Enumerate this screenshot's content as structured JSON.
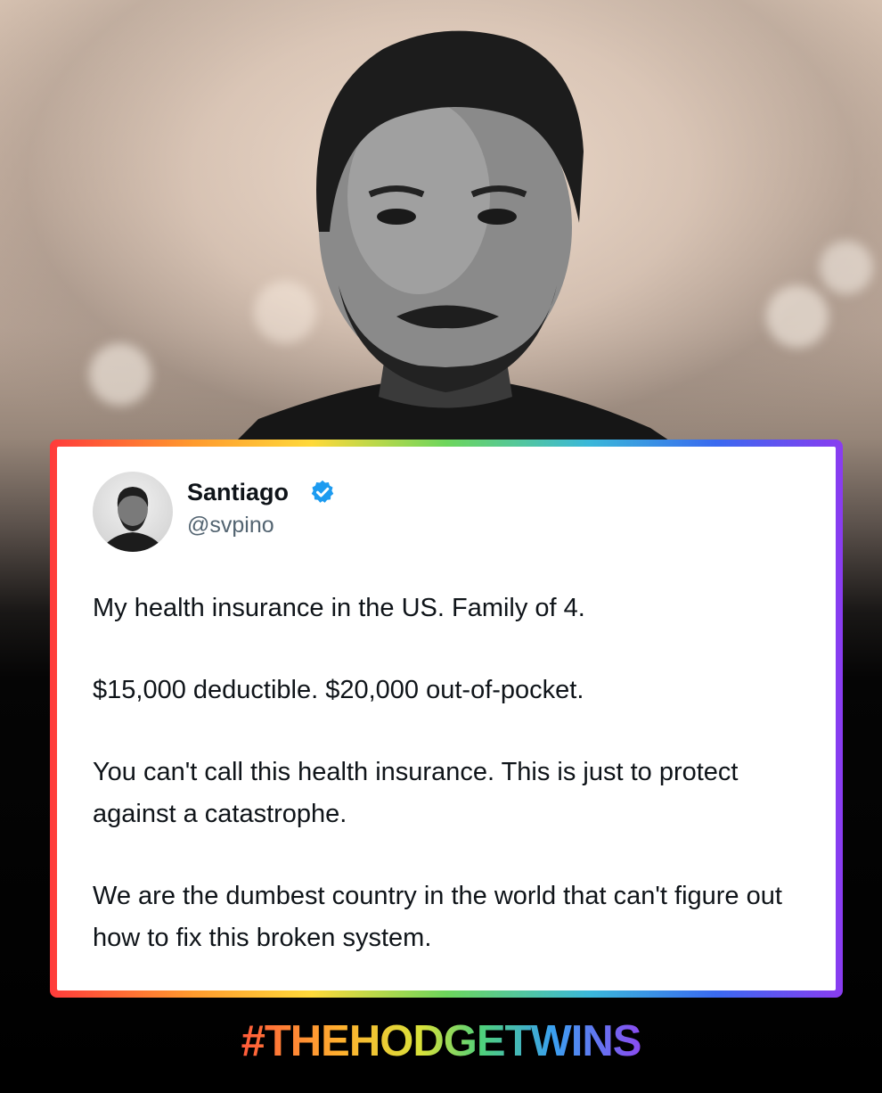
{
  "tweet": {
    "author_name": "Santiago",
    "handle": "@svpino",
    "verified": true,
    "paragraphs": [
      "My health insurance in the US. Family of 4.",
      "$15,000 deductible. $20,000 out-of-pocket.",
      "You can't call this health insurance. This is just to protect against a catastrophe.",
      "We are the dumbest country in the world that can't figure out how to fix this broken system."
    ]
  },
  "footer": {
    "hashtag": "#THEHODGETWINS"
  },
  "colors": {
    "verified_badge": "#1d9bf0",
    "text_primary": "#0f1419",
    "text_secondary": "#536471",
    "frame_gradient": [
      "#ff3b3b",
      "#ff9a2e",
      "#ffd93a",
      "#6dd65c",
      "#3bb8d9",
      "#3a6af0",
      "#8a3cf0"
    ]
  }
}
